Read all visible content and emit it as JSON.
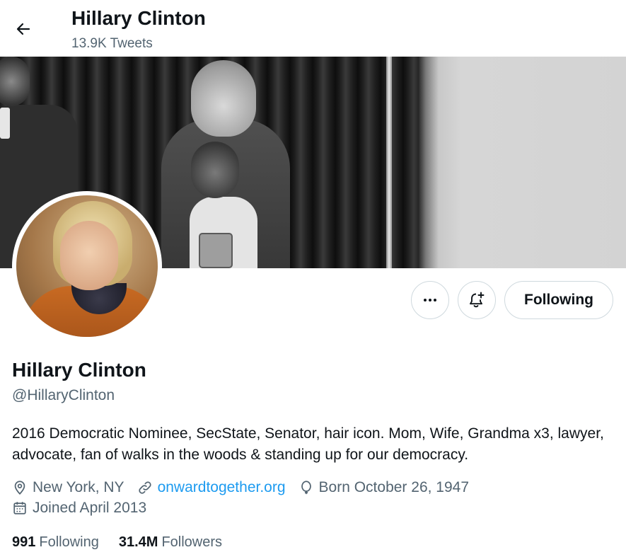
{
  "header": {
    "title": "Hillary Clinton",
    "tweet_count": "13.9K Tweets",
    "back_icon": "arrow-left-icon"
  },
  "actions": {
    "more_icon": "more-horizontal-icon",
    "notify_icon": "bell-plus-icon",
    "following_label": "Following"
  },
  "profile": {
    "display_name": "Hillary Clinton",
    "handle": "@HillaryClinton",
    "bio": "2016 Democratic Nominee, SecState, Senator, hair icon. Mom, Wife, Grandma x3, lawyer, advocate, fan of walks in the woods & standing up for our democracy.",
    "location": "New York, NY",
    "website": "onwardtogether.org",
    "birthday": "Born October 26, 1947",
    "joined": "Joined April 2013"
  },
  "stats": {
    "following_count": "991",
    "following_label": "Following",
    "followers_count": "31.4M",
    "followers_label": "Followers"
  },
  "colors": {
    "text_primary": "#0f1419",
    "text_secondary": "#536471",
    "link": "#1d9bf0",
    "border": "#cfd9de"
  }
}
